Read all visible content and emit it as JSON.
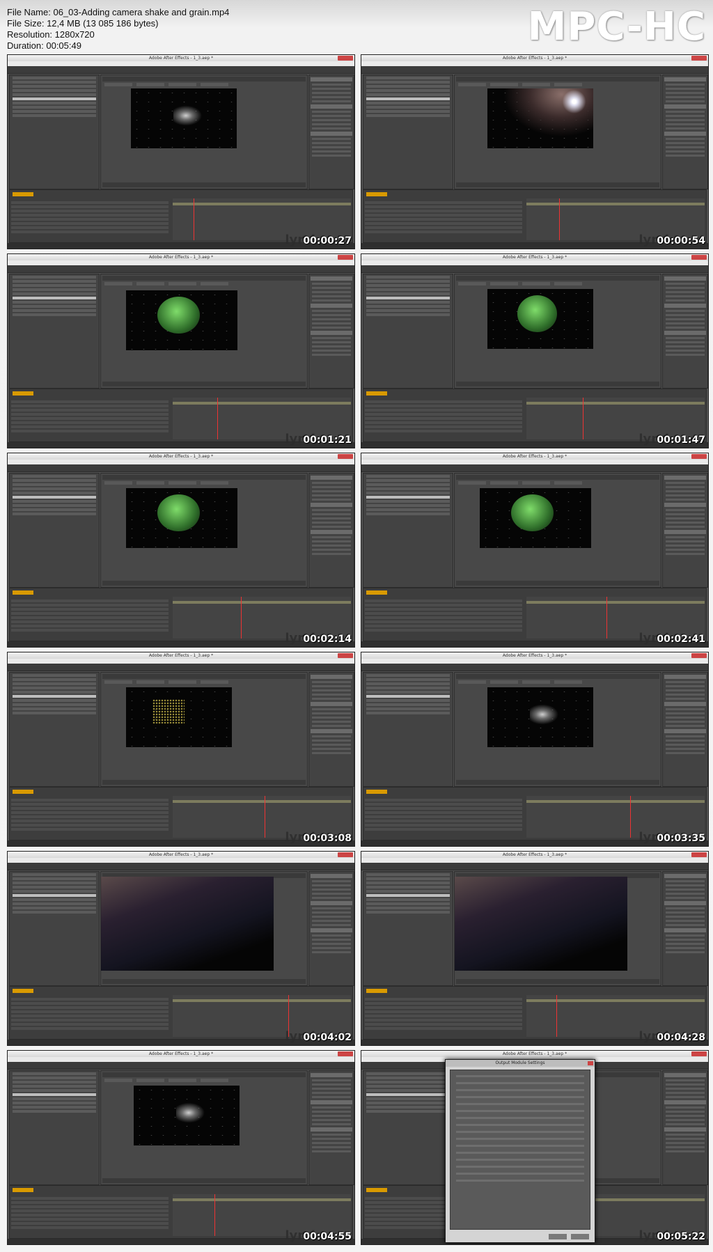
{
  "file_info": {
    "file_name": "File Name: 06_03-Adding camera shake and grain.mp4",
    "file_size": "File Size: 12,4 MB (13 085 186 bytes)",
    "resolution": "Resolution: 1280x720",
    "duration": "Duration: 00:05:49"
  },
  "player_logo": "MPC-HC",
  "thumbnails": [
    {
      "timestamp": "00:00:27",
      "window_title": "Adobe After Effects - 1_3.aep *",
      "watermark": "lynd",
      "scene": "ship"
    },
    {
      "timestamp": "00:00:54",
      "window_title": "Adobe After Effects - 1_3.aep *",
      "watermark": "lynd",
      "scene": "planet-flare"
    },
    {
      "timestamp": "00:01:21",
      "window_title": "Adobe After Effects - 1_3.aep *",
      "watermark": "lynd",
      "scene": "green-planet-near"
    },
    {
      "timestamp": "00:01:47",
      "window_title": "Adobe After Effects - 1_3.aep *",
      "watermark": "lynd",
      "scene": "green-planet"
    },
    {
      "timestamp": "00:02:14",
      "window_title": "Adobe After Effects - 1_3.aep *",
      "watermark": "lynd",
      "scene": "green-planet-big"
    },
    {
      "timestamp": "00:02:41",
      "window_title": "Adobe After Effects - 1_3.aep *",
      "watermark": "lynd",
      "scene": "green-planet-big"
    },
    {
      "timestamp": "00:03:08",
      "window_title": "Adobe After Effects - 1_3.aep *",
      "watermark": "lynd",
      "scene": "debris"
    },
    {
      "timestamp": "00:03:35",
      "window_title": "Adobe After Effects - 1_3.aep *",
      "watermark": "lynd",
      "scene": "ship-blur"
    },
    {
      "timestamp": "00:04:02",
      "window_title": "Adobe After Effects - 1_3.aep *",
      "watermark": "lynd",
      "scene": "blur-zoom"
    },
    {
      "timestamp": "00:04:28",
      "window_title": "Adobe After Effects - 1_3.aep *",
      "watermark": "lynd",
      "scene": "blur-zoom-2"
    },
    {
      "timestamp": "00:04:55",
      "window_title": "Adobe After Effects - 1_3.aep *",
      "watermark": "lynd",
      "scene": "ship-blur"
    },
    {
      "timestamp": "00:05:22",
      "window_title": "Adobe After Effects - 1_3.aep *",
      "watermark": "lynd",
      "scene": "dialog",
      "dialog_title": "Output Module Settings"
    }
  ],
  "colors": {
    "background": "#f2f2f2",
    "ae_panel": "#434343",
    "timecode": "#d99a00",
    "playhead": "#ee3333",
    "planet_green": "#7fdc6a"
  }
}
